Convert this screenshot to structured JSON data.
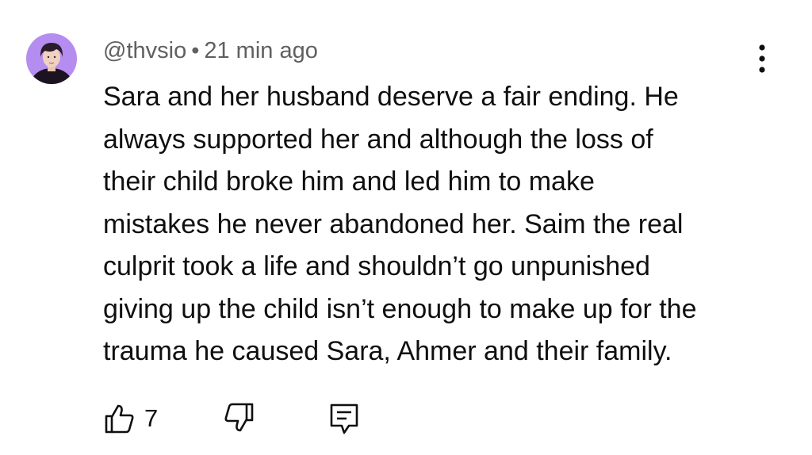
{
  "comment": {
    "author": "@thvsio",
    "separator": "•",
    "timestamp": "21 min ago",
    "text": "Sara and her husband deserve a fair ending. He\nalways supported her and although the loss of\ntheir child broke him and led him to make\nmistakes he never abandoned her. Saim the real\nculprit took a life and shouldn’t go unpunished\ngiving up the child isn’t enough to make up for the\ntrauma he caused Sara, Ahmer and their family.",
    "like_count": "7"
  },
  "icons": {
    "avatar": "user-avatar-photo",
    "menu": "vertical-dots-icon",
    "like": "thumbs-up-icon",
    "dislike": "thumbs-down-icon",
    "reply": "comment-reply-icon"
  },
  "colors": {
    "text": "#0f0f0f",
    "meta": "#606060",
    "avatar_bg": "#b58cf0"
  }
}
